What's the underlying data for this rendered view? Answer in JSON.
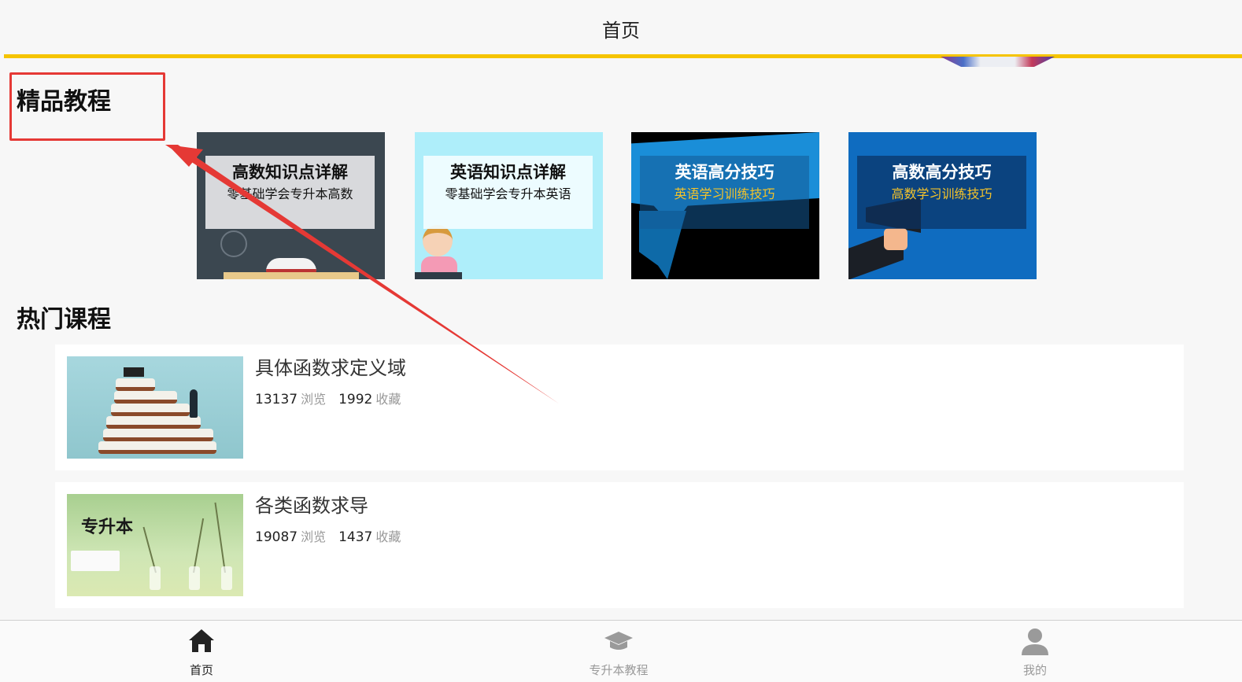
{
  "header": {
    "title": "首页"
  },
  "sections": {
    "premium_title": "精品教程",
    "hot_title": "热门课程"
  },
  "premium": [
    {
      "title": "高数知识点详解",
      "subtitle": "零基础学会专升本高数"
    },
    {
      "title": "英语知识点详解",
      "subtitle": "零基础学会专升本英语"
    },
    {
      "title": "英语高分技巧",
      "subtitle": "英语学习训练技巧"
    },
    {
      "title": "高数高分技巧",
      "subtitle": "高数学习训练技巧"
    }
  ],
  "courses": [
    {
      "title": "具体函数求定义域",
      "views": "13137",
      "views_unit": "浏览",
      "favs": "1992",
      "favs_unit": "收藏"
    },
    {
      "title": "各类函数求导",
      "views": "19087",
      "views_unit": "浏览",
      "favs": "1437",
      "favs_unit": "收藏"
    }
  ],
  "thumb_text": {
    "course2_label": "专升本"
  },
  "tabbar": [
    {
      "label": "首页",
      "icon": "home-icon",
      "active": true
    },
    {
      "label": "专升本教程",
      "icon": "graduation-cap-icon",
      "active": false
    },
    {
      "label": "我的",
      "icon": "user-icon",
      "active": false
    }
  ],
  "colors": {
    "accent_line": "#f5c400",
    "highlight_box": "#e53935",
    "annotation_arrow": "#e53935"
  }
}
